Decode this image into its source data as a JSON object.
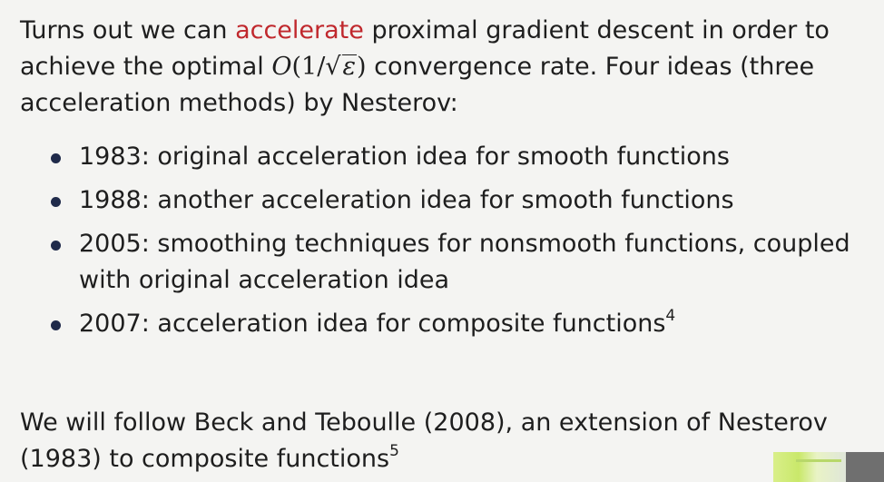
{
  "intro": {
    "text_before": "Turns out we can ",
    "accent_word": "accelerate",
    "text_after_accent": " proximal gradient descent in order to achieve the optimal ",
    "math_O": "O",
    "math_open": "(1/",
    "math_epsilon": "ε",
    "math_close": ")",
    "text_end": " convergence rate. Four ideas (three acceleration methods) by Nesterov:"
  },
  "bullets": [
    {
      "text": "1983: original acceleration idea for smooth functions",
      "footnote": ""
    },
    {
      "text": "1988: another acceleration idea for smooth functions",
      "footnote": ""
    },
    {
      "text": "2005: smoothing techniques for nonsmooth functions, coupled with original acceleration idea",
      "footnote": ""
    },
    {
      "text": "2007: acceleration idea for composite functions",
      "footnote": "4"
    }
  ],
  "outro": {
    "text": "We will follow Beck and Teboulle (2008), an extension of Nesterov (1983) to composite functions",
    "footnote": "5"
  },
  "colors": {
    "accent": "#c0282d",
    "text": "#1e1e1e",
    "background": "#f4f4f2",
    "bullet": "#1f2a4a"
  }
}
